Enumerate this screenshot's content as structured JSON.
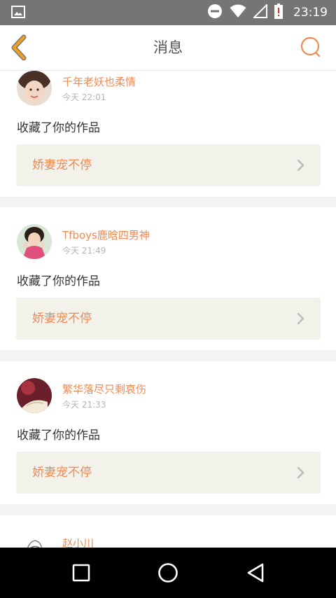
{
  "status_bar": {
    "time": "23:19",
    "icons": [
      "gallery-icon",
      "do-not-disturb-icon",
      "wifi-icon",
      "signal-icon",
      "battery-alert-icon"
    ]
  },
  "header": {
    "title": "消息",
    "back_icon": "chevron-left-icon",
    "search_icon": "search-icon",
    "accent_color": "#f0a020",
    "search_color": "#f08a52"
  },
  "notifications": [
    {
      "username": "千年老妖也柔情",
      "time": "今天 22:01",
      "action": "收藏了你的作品",
      "work_title": "娇妻宠不停"
    },
    {
      "username": "Tfboys鹿晗四男神",
      "time": "今天 21:49",
      "action": "收藏了你的作品",
      "work_title": "娇妻宠不停"
    },
    {
      "username": "繁华落尽只剩哀伤",
      "time": "今天 21:33",
      "action": "收藏了你的作品",
      "work_title": "娇妻宠不停"
    },
    {
      "username": "赵小川"
    }
  ],
  "colors": {
    "username": "#f08a52",
    "timestamp": "#b5b5b5",
    "link_background": "#f2f1ea",
    "page_background": "#f3f3f3"
  },
  "nav": {
    "recents_icon": "square-recents-icon",
    "home_icon": "circle-home-icon",
    "back_icon": "triangle-back-icon"
  }
}
